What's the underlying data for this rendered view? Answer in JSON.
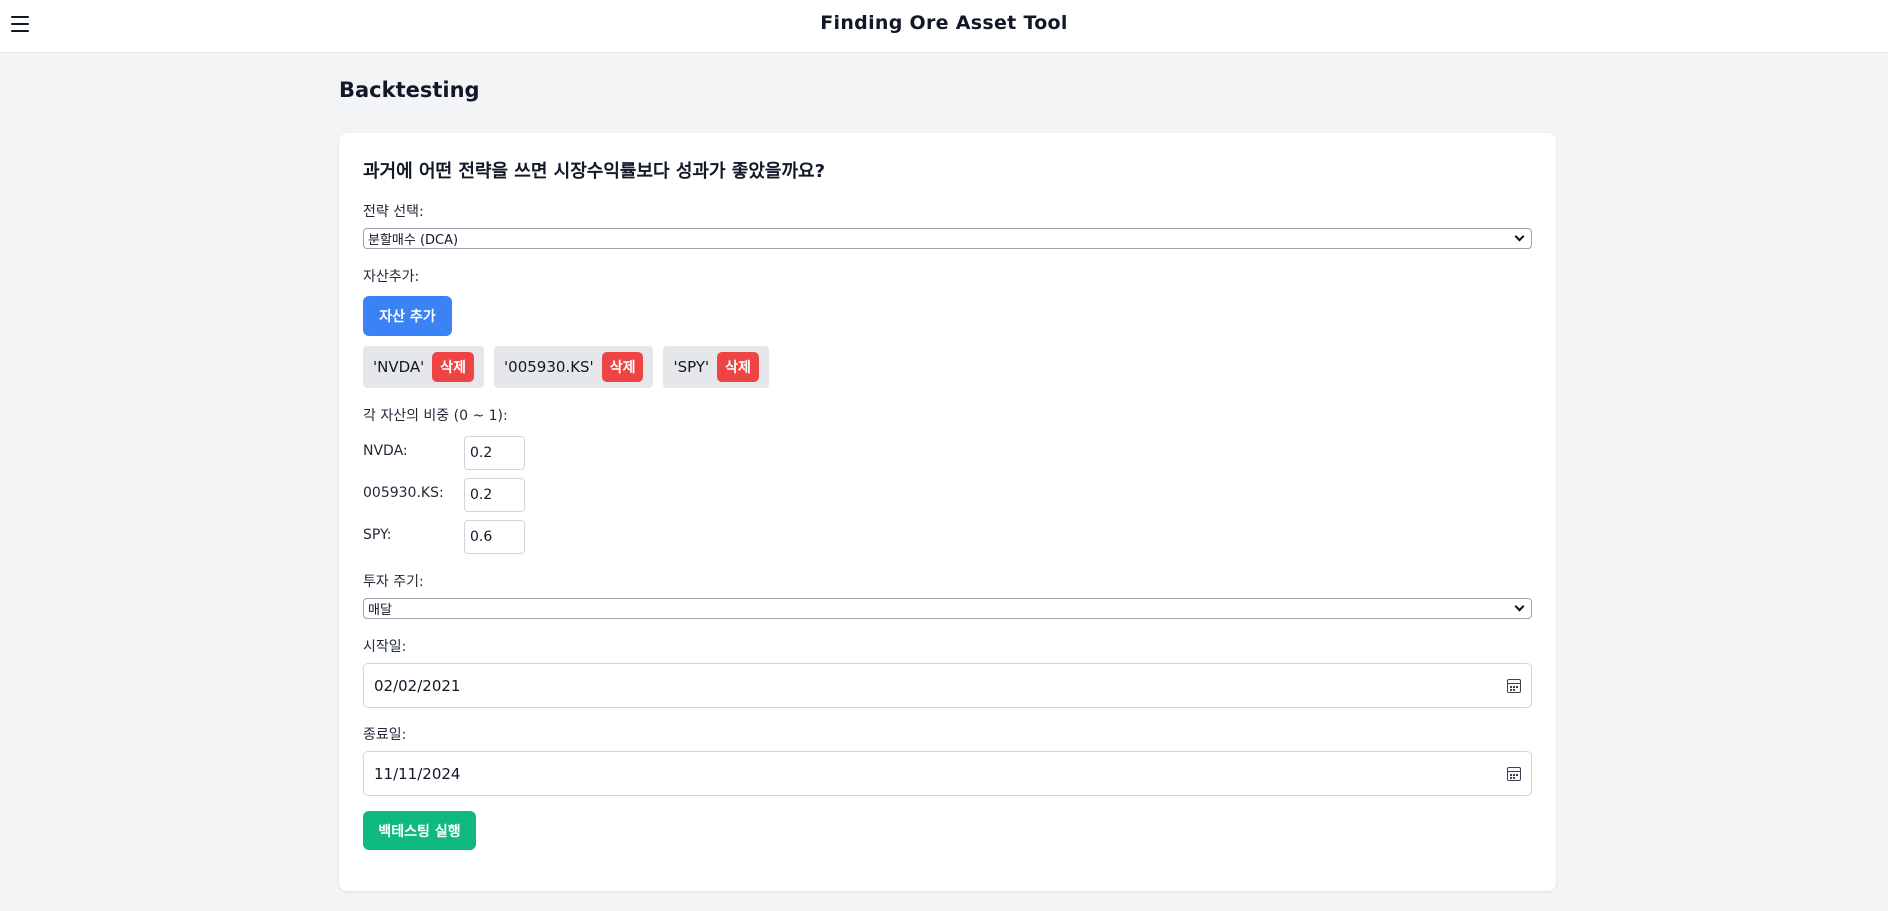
{
  "header": {
    "title": "Finding Ore Asset Tool"
  },
  "page": {
    "title": "Backtesting"
  },
  "form": {
    "question": "과거에 어떤 전략을 쓰면 시장수익률보다 성과가 좋았을까요?",
    "strategy": {
      "label": "전략 선택:",
      "value": "분할매수 (DCA)"
    },
    "assets": {
      "label": "자산추가:",
      "add_button": "자산 추가",
      "chips": [
        {
          "name": "'NVDA'",
          "delete": "삭제"
        },
        {
          "name": "'005930.KS'",
          "delete": "삭제"
        },
        {
          "name": "'SPY'",
          "delete": "삭제"
        }
      ]
    },
    "weights": {
      "label": "각 자산의 비중 (0 ~ 1):",
      "rows": [
        {
          "label": "NVDA:",
          "value": "0.2"
        },
        {
          "label": "005930.KS:",
          "value": "0.2"
        },
        {
          "label": "SPY:",
          "value": "0.6"
        }
      ]
    },
    "period": {
      "label": "투자 주기:",
      "value": "매달"
    },
    "start_date": {
      "label": "시작일:",
      "value": "02/02/2021"
    },
    "end_date": {
      "label": "종료일:",
      "value": "11/11/2024"
    },
    "run_button": "백테스팅 실행"
  }
}
